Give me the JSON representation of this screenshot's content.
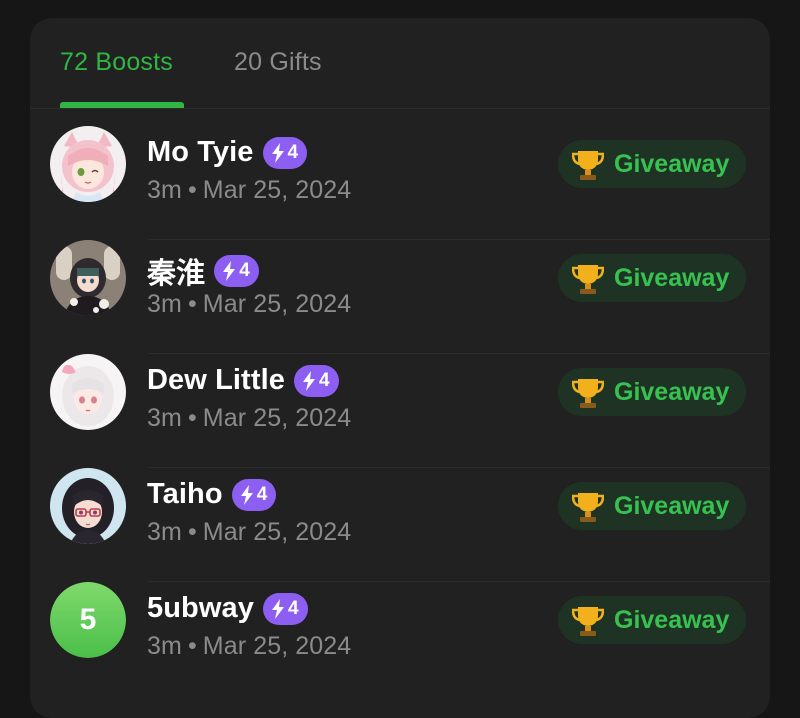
{
  "tabs": {
    "boosts_label": "72 Boosts",
    "gifts_label": "20 Gifts",
    "active": "boosts"
  },
  "colors": {
    "accent_green": "#31b545",
    "badge_purple": "#8d5ef2",
    "panel_bg": "#212121",
    "page_bg": "#161616"
  },
  "boosters": [
    {
      "name": "Mo Tyie",
      "badge_count": "4",
      "time": "3m",
      "separator": "•",
      "date": "Mar 25, 2024",
      "action_label": "Giveaway",
      "avatar": "anime-girl-pink-hair-avatar"
    },
    {
      "name": "秦淮",
      "badge_count": "4",
      "time": "3m",
      "separator": "•",
      "date": "Mar 25, 2024",
      "action_label": "Giveaway",
      "avatar": "anime-girl-church-avatar"
    },
    {
      "name": "Dew Little",
      "badge_count": "4",
      "time": "3m",
      "separator": "•",
      "date": "Mar 25, 2024",
      "action_label": "Giveaway",
      "avatar": "anime-girl-white-hair-avatar"
    },
    {
      "name": "Taiho",
      "badge_count": "4",
      "time": "3m",
      "separator": "•",
      "date": "Mar 25, 2024",
      "action_label": "Giveaway",
      "avatar": "anime-girl-glasses-avatar"
    },
    {
      "name": "5ubway",
      "badge_count": "4",
      "time": "3m",
      "separator": "•",
      "date": "Mar 25, 2024",
      "action_label": "Giveaway",
      "avatar_letter": "5"
    }
  ],
  "icons": {
    "badge": "lightning-bolt-icon",
    "action": "trophy-icon"
  }
}
